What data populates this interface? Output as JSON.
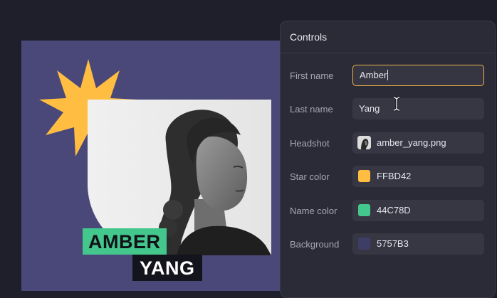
{
  "panel": {
    "title": "Controls",
    "fields": {
      "first_name": {
        "label": "First name",
        "value": "Amber"
      },
      "last_name": {
        "label": "Last name",
        "value": "Yang"
      },
      "headshot": {
        "label": "Headshot",
        "value": "amber_yang.png"
      },
      "star_color": {
        "label": "Star color",
        "value": "FFBD42",
        "color": "#FFBD42"
      },
      "name_color": {
        "label": "Name color",
        "value": "44C78D",
        "color": "#44C78D"
      },
      "background": {
        "label": "Background",
        "value": "5757B3",
        "color": "#3e3d66"
      }
    }
  },
  "canvas": {
    "first_name": "AMBER",
    "last_name": "YANG",
    "colors": {
      "star": "#FFBD42",
      "name": "#44C78D",
      "background": "#4a4878"
    }
  }
}
